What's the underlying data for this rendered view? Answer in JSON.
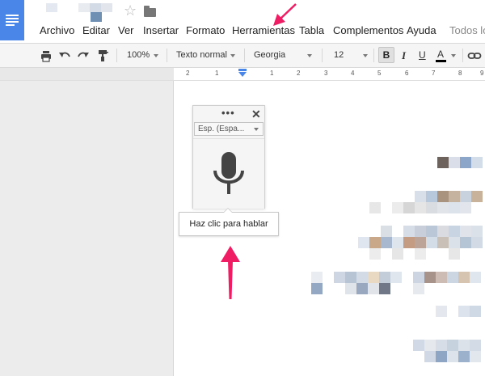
{
  "menu": {
    "items": [
      "Archivo",
      "Editar",
      "Ver",
      "Insertar",
      "Formato",
      "Herramientas",
      "Tabla",
      "Complementos",
      "Ayuda",
      "Todos los"
    ]
  },
  "toolbar": {
    "zoom": "100%",
    "style": "Texto normal",
    "font": "Georgia",
    "size": "12",
    "bold_label": "B",
    "italic_label": "I",
    "underline_label": "U",
    "text_color_label": "A"
  },
  "ruler": {
    "numbers": [
      "2",
      "1",
      "1",
      "2",
      "3",
      "4",
      "5",
      "6",
      "7",
      "8",
      "9"
    ]
  },
  "voice_typing": {
    "menu_dots": "•••",
    "close_label": "✕",
    "language": "Esp. (Espa...",
    "tooltip": "Haz clic para hablar"
  },
  "colors": {
    "arrow": "#ef1d63",
    "brand_blue": "#4a86e8"
  },
  "icons": [
    "docs-logo-icon",
    "star-icon",
    "folder-icon",
    "print-icon",
    "undo-icon",
    "redo-icon",
    "paint-format-icon",
    "microphone-icon",
    "link-icon",
    "caret-icon"
  ]
}
